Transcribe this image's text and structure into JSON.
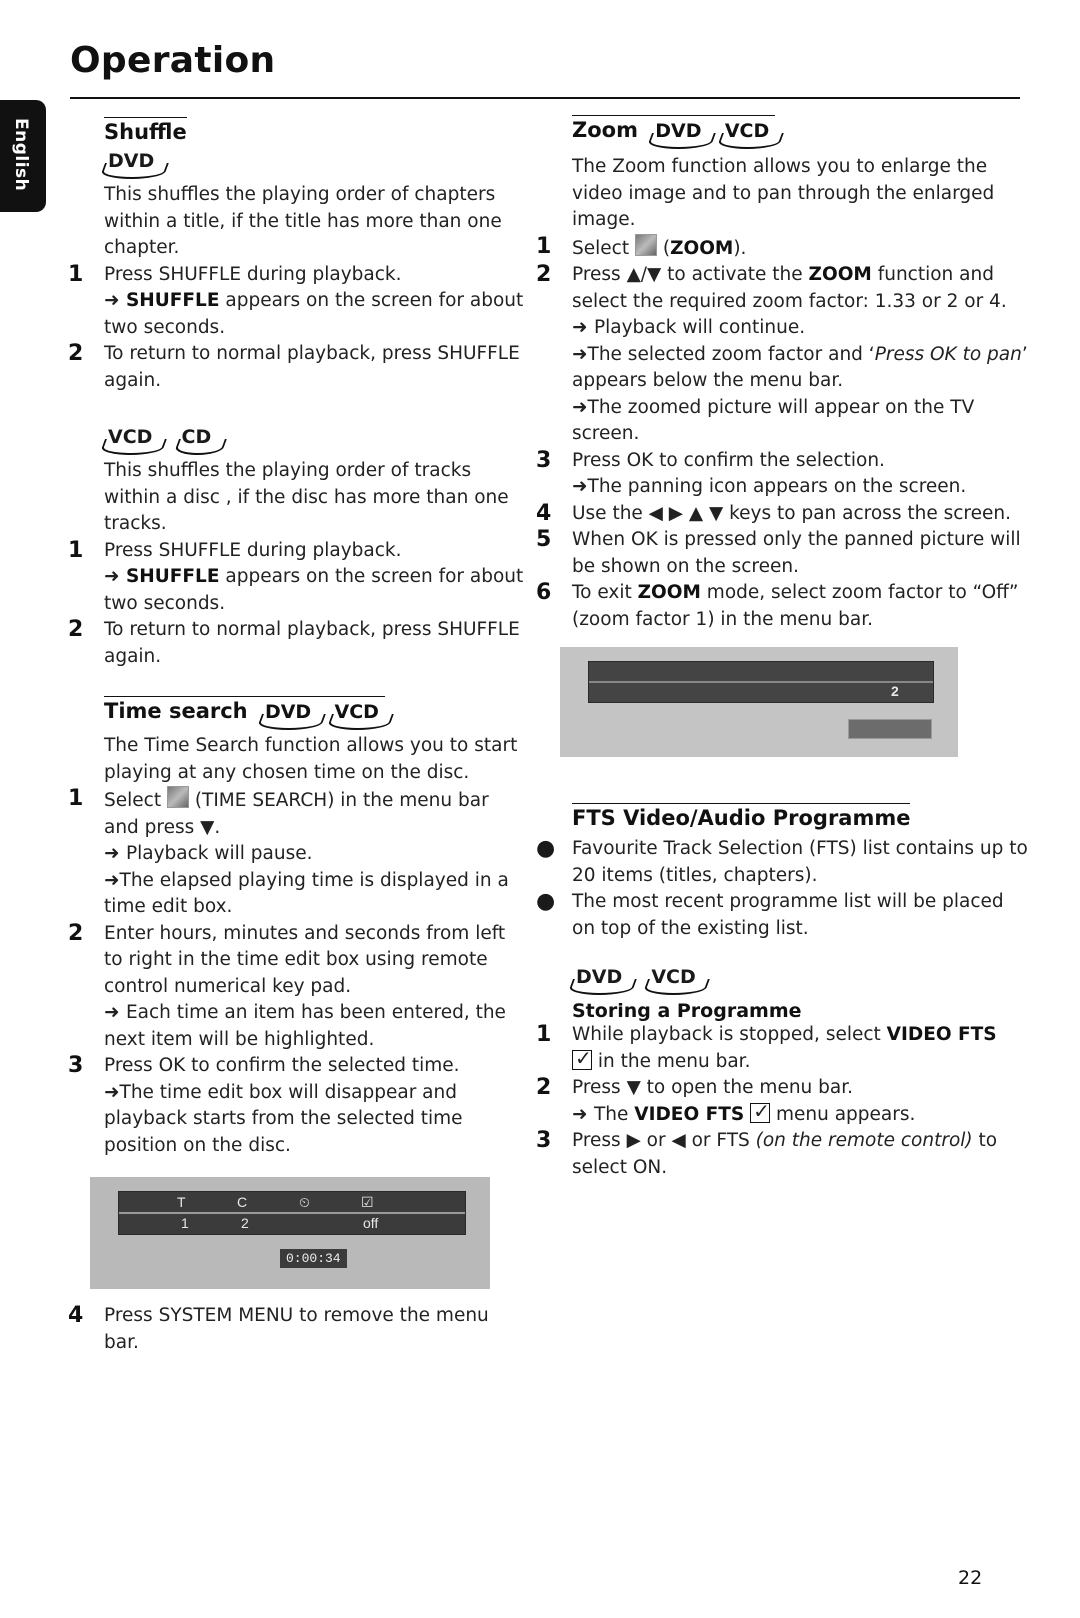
{
  "page": {
    "title": "Operation",
    "language_tab": "English",
    "page_number": "22"
  },
  "shuffle": {
    "heading": "Shuffle",
    "dvd_badge": "DVD",
    "dvd_intro": "This shuffles the playing order of chapters within a title, if the title has more than one chapter.",
    "dvd_steps": [
      {
        "num": "1",
        "text": "Press SHUFFLE during playback.",
        "result_bold": "SHUFFLE",
        "result_text": " appears on the screen for about two seconds."
      },
      {
        "num": "2",
        "text": "To return to normal playback, press SHUFFLE again."
      }
    ],
    "vcd_badges": [
      "VCD",
      "CD"
    ],
    "vcd_intro": "This shuffles the playing order of tracks within a disc , if the disc has more than one tracks.",
    "vcd_steps": [
      {
        "num": "1",
        "text": "Press SHUFFLE during playback.",
        "result_bold": "SHUFFLE",
        "result_text": " appears on the screen for about two seconds."
      },
      {
        "num": "2",
        "text": "To return to normal playback, press SHUFFLE again."
      }
    ]
  },
  "time_search": {
    "heading": "Time search",
    "badges": [
      "DVD",
      "VCD"
    ],
    "intro": "The Time Search function allows you to start playing at any chosen time on the disc.",
    "steps": [
      {
        "num": "1",
        "pre": "Select ",
        "post": " (TIME SEARCH) in the menu bar and press ▼.",
        "results": [
          "Playback will pause.",
          "The elapsed playing time is displayed in a time edit box."
        ]
      },
      {
        "num": "2",
        "text": "Enter hours, minutes and seconds from left to right in the time edit box using remote control numerical key pad.",
        "results": [
          "Each time an item has been entered, the next item will be highlighted."
        ]
      },
      {
        "num": "3",
        "text": "Press OK to confirm the selected time.",
        "results": [
          "The time edit box will disappear and playback starts from the selected time position on the disc."
        ]
      },
      {
        "num": "4",
        "text": "Press SYSTEM MENU to remove the menu bar."
      }
    ],
    "screenshot": {
      "header_labels": [
        "T",
        "C",
        "⏲",
        "☑"
      ],
      "values": [
        "1",
        "2",
        "",
        "off"
      ],
      "time_box": "0:00:34"
    }
  },
  "zoom": {
    "heading": "Zoom",
    "badges": [
      "DVD",
      "VCD"
    ],
    "intro": "The Zoom function allows you to enlarge the video image and to pan through the enlarged image.",
    "step1_pre": "Select ",
    "step1_bold": "ZOOM",
    "step2_pre": "Press ▲/▼ to activate the ",
    "step2_bold": "ZOOM",
    "step2_post": " function and select the required zoom factor: 1.33 or 2 or 4.",
    "step2_results": [
      "Playback will continue."
    ],
    "step2_result2_pre": "The selected zoom factor and ‘",
    "step2_result2_italic": "Press OK to pan",
    "step2_result2_post": "’ appears below the menu bar.",
    "step2_result3": "The zoomed picture will appear on the TV screen.",
    "step3": "Press OK to confirm the selection.",
    "step3_result": "The panning icon appears on the screen.",
    "step4": "Use the ◀ ▶ ▲ ▼ keys to pan across the screen.",
    "step5": "When OK is pressed only the panned picture will be shown on the screen.",
    "step6_pre": "To exit ",
    "step6_bold": "ZOOM",
    "step6_post": " mode, select zoom factor to “Off” (zoom factor 1) in the menu bar.",
    "screenshot": {
      "zoom_value": "2"
    }
  },
  "fts": {
    "heading": "FTS Video/Audio Programme",
    "bullets": [
      "Favourite Track Selection (FTS) list contains up to 20 items (titles, chapters).",
      "The most recent programme list will be placed on top of the existing list."
    ],
    "badges": [
      "DVD",
      "VCD"
    ],
    "subheading": "Storing a Programme",
    "step1_pre": "While playback is stopped, select ",
    "step1_bold": "VIDEO FTS",
    "step1_post": " in the menu bar.",
    "step2": "Press ▼ to open the menu bar.",
    "step2_result_pre": "The ",
    "step2_result_bold": "VIDEO FTS",
    "step2_result_post": " menu appears.",
    "step3_pre": "Press ▶ or ◀ or FTS ",
    "step3_italic": "(on the remote control)",
    "step3_post": " to select ON."
  }
}
